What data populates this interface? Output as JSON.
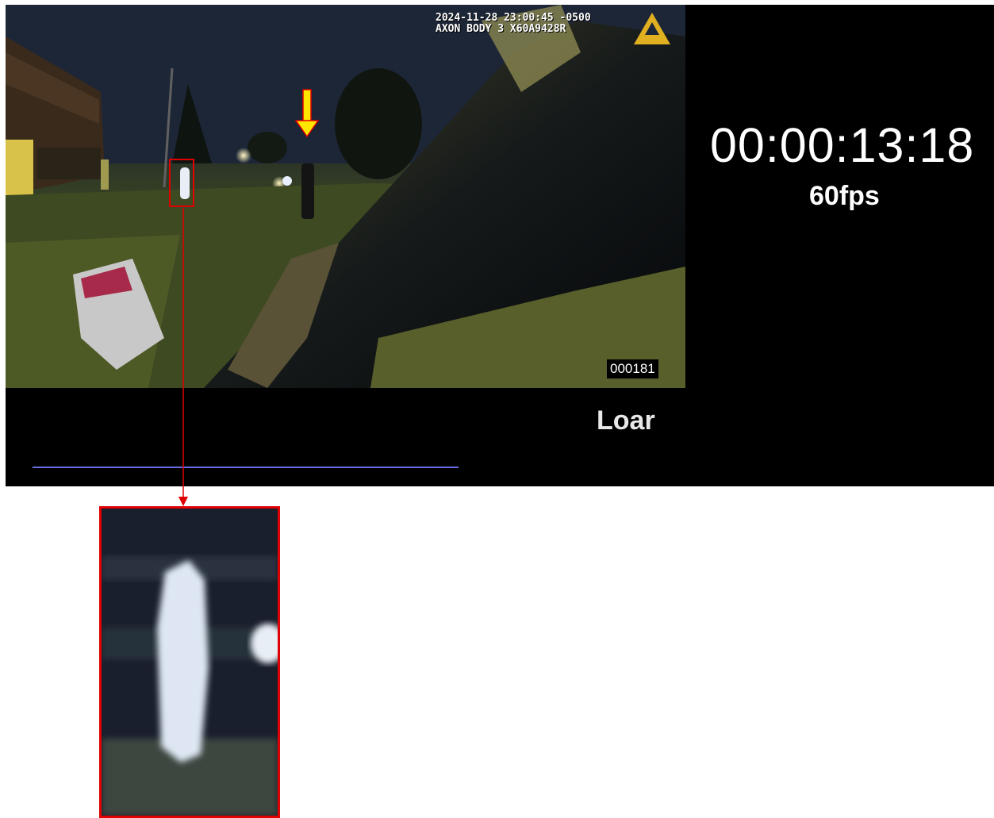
{
  "video": {
    "timestamp_line": "2024-11-28 23:00:45 -0500",
    "device_line": "AXON BODY 3 X60A9428R",
    "frame_number": "000181",
    "logo": "axon-triangle-icon"
  },
  "overlay": {
    "timecode": "00:00:13:18",
    "fps": "60fps",
    "name": "Loar"
  },
  "annotations": {
    "marker_arrow_color": "#ffe600",
    "highlight_color": "#e00000",
    "progress_color": "#6a6ae0"
  }
}
